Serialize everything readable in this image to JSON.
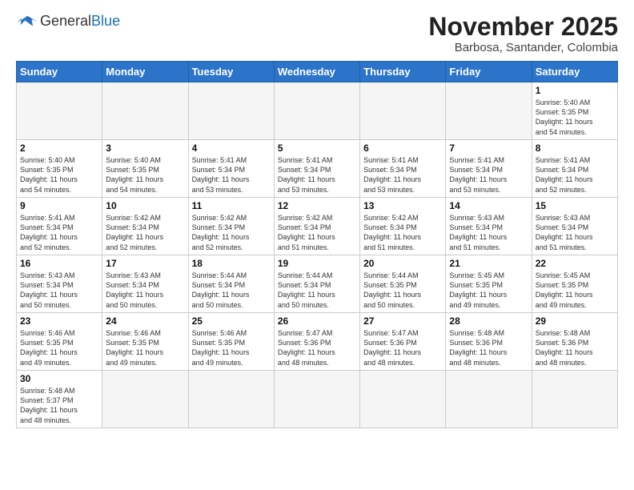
{
  "logo": {
    "text_general": "General",
    "text_blue": "Blue"
  },
  "title": "November 2025",
  "location": "Barbosa, Santander, Colombia",
  "days_of_week": [
    "Sunday",
    "Monday",
    "Tuesday",
    "Wednesday",
    "Thursday",
    "Friday",
    "Saturday"
  ],
  "weeks": [
    [
      {
        "day": "",
        "info": ""
      },
      {
        "day": "",
        "info": ""
      },
      {
        "day": "",
        "info": ""
      },
      {
        "day": "",
        "info": ""
      },
      {
        "day": "",
        "info": ""
      },
      {
        "day": "",
        "info": ""
      },
      {
        "day": "1",
        "info": "Sunrise: 5:40 AM\nSunset: 5:35 PM\nDaylight: 11 hours\nand 54 minutes."
      }
    ],
    [
      {
        "day": "2",
        "info": "Sunrise: 5:40 AM\nSunset: 5:35 PM\nDaylight: 11 hours\nand 54 minutes."
      },
      {
        "day": "3",
        "info": "Sunrise: 5:40 AM\nSunset: 5:35 PM\nDaylight: 11 hours\nand 54 minutes."
      },
      {
        "day": "4",
        "info": "Sunrise: 5:41 AM\nSunset: 5:34 PM\nDaylight: 11 hours\nand 53 minutes."
      },
      {
        "day": "5",
        "info": "Sunrise: 5:41 AM\nSunset: 5:34 PM\nDaylight: 11 hours\nand 53 minutes."
      },
      {
        "day": "6",
        "info": "Sunrise: 5:41 AM\nSunset: 5:34 PM\nDaylight: 11 hours\nand 53 minutes."
      },
      {
        "day": "7",
        "info": "Sunrise: 5:41 AM\nSunset: 5:34 PM\nDaylight: 11 hours\nand 53 minutes."
      },
      {
        "day": "8",
        "info": "Sunrise: 5:41 AM\nSunset: 5:34 PM\nDaylight: 11 hours\nand 52 minutes."
      }
    ],
    [
      {
        "day": "9",
        "info": "Sunrise: 5:41 AM\nSunset: 5:34 PM\nDaylight: 11 hours\nand 52 minutes."
      },
      {
        "day": "10",
        "info": "Sunrise: 5:42 AM\nSunset: 5:34 PM\nDaylight: 11 hours\nand 52 minutes."
      },
      {
        "day": "11",
        "info": "Sunrise: 5:42 AM\nSunset: 5:34 PM\nDaylight: 11 hours\nand 52 minutes."
      },
      {
        "day": "12",
        "info": "Sunrise: 5:42 AM\nSunset: 5:34 PM\nDaylight: 11 hours\nand 51 minutes."
      },
      {
        "day": "13",
        "info": "Sunrise: 5:42 AM\nSunset: 5:34 PM\nDaylight: 11 hours\nand 51 minutes."
      },
      {
        "day": "14",
        "info": "Sunrise: 5:43 AM\nSunset: 5:34 PM\nDaylight: 11 hours\nand 51 minutes."
      },
      {
        "day": "15",
        "info": "Sunrise: 5:43 AM\nSunset: 5:34 PM\nDaylight: 11 hours\nand 51 minutes."
      }
    ],
    [
      {
        "day": "16",
        "info": "Sunrise: 5:43 AM\nSunset: 5:34 PM\nDaylight: 11 hours\nand 50 minutes."
      },
      {
        "day": "17",
        "info": "Sunrise: 5:43 AM\nSunset: 5:34 PM\nDaylight: 11 hours\nand 50 minutes."
      },
      {
        "day": "18",
        "info": "Sunrise: 5:44 AM\nSunset: 5:34 PM\nDaylight: 11 hours\nand 50 minutes."
      },
      {
        "day": "19",
        "info": "Sunrise: 5:44 AM\nSunset: 5:34 PM\nDaylight: 11 hours\nand 50 minutes."
      },
      {
        "day": "20",
        "info": "Sunrise: 5:44 AM\nSunset: 5:35 PM\nDaylight: 11 hours\nand 50 minutes."
      },
      {
        "day": "21",
        "info": "Sunrise: 5:45 AM\nSunset: 5:35 PM\nDaylight: 11 hours\nand 49 minutes."
      },
      {
        "day": "22",
        "info": "Sunrise: 5:45 AM\nSunset: 5:35 PM\nDaylight: 11 hours\nand 49 minutes."
      }
    ],
    [
      {
        "day": "23",
        "info": "Sunrise: 5:46 AM\nSunset: 5:35 PM\nDaylight: 11 hours\nand 49 minutes."
      },
      {
        "day": "24",
        "info": "Sunrise: 5:46 AM\nSunset: 5:35 PM\nDaylight: 11 hours\nand 49 minutes."
      },
      {
        "day": "25",
        "info": "Sunrise: 5:46 AM\nSunset: 5:35 PM\nDaylight: 11 hours\nand 49 minutes."
      },
      {
        "day": "26",
        "info": "Sunrise: 5:47 AM\nSunset: 5:36 PM\nDaylight: 11 hours\nand 48 minutes."
      },
      {
        "day": "27",
        "info": "Sunrise: 5:47 AM\nSunset: 5:36 PM\nDaylight: 11 hours\nand 48 minutes."
      },
      {
        "day": "28",
        "info": "Sunrise: 5:48 AM\nSunset: 5:36 PM\nDaylight: 11 hours\nand 48 minutes."
      },
      {
        "day": "29",
        "info": "Sunrise: 5:48 AM\nSunset: 5:36 PM\nDaylight: 11 hours\nand 48 minutes."
      }
    ],
    [
      {
        "day": "30",
        "info": "Sunrise: 5:48 AM\nSunset: 5:37 PM\nDaylight: 11 hours\nand 48 minutes."
      },
      {
        "day": "",
        "info": ""
      },
      {
        "day": "",
        "info": ""
      },
      {
        "day": "",
        "info": ""
      },
      {
        "day": "",
        "info": ""
      },
      {
        "day": "",
        "info": ""
      },
      {
        "day": "",
        "info": ""
      }
    ]
  ]
}
